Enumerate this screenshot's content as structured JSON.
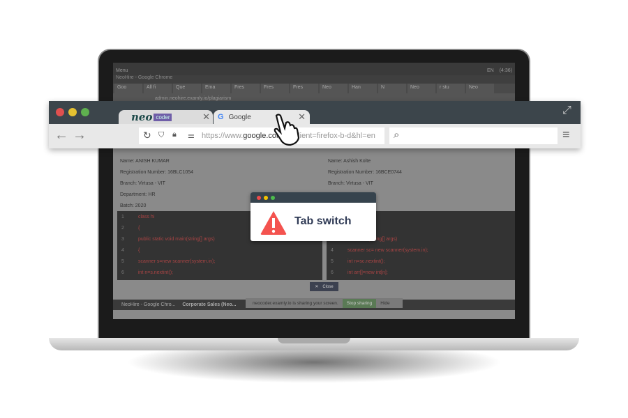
{
  "system_bar": {
    "menu": "Menu",
    "time": "(4:36)",
    "lang": "EN"
  },
  "window_title": "NeoHire - Google Chrome",
  "background_tabs": [
    "Goo",
    "All fi",
    "Que",
    "Ema",
    "Fres",
    "Fres",
    "Fres",
    "Neo",
    "Han",
    "N",
    "Neo",
    "r stu",
    "Neo"
  ],
  "background_url": "admin.neohire.examly.io/plagiarism",
  "candidates": [
    {
      "name": "Name: ANISH KUMAR",
      "reg": "Registration Number: 16BLC1054",
      "branch": "Branch: Virtusa - VIT",
      "dept": "Department: HR",
      "batch": "Batch: 2020",
      "code": [
        [
          "1",
          "class hi"
        ],
        [
          "2",
          "{"
        ],
        [
          "3",
          "public static void main(string[] args)"
        ],
        [
          "4",
          "{"
        ],
        [
          "5",
          "scanner s=new scanner(system.in);"
        ],
        [
          "6",
          "int n=s.nextint();"
        ]
      ]
    },
    {
      "name": "Name: Ashish Kolte",
      "reg": "Registration Number: 16BCE0744",
      "branch": "Branch: Virtusa - VIT",
      "code": [
        [
          "",
          "void main(string[] args)"
        ],
        [
          "4",
          "scanner sc= new scanner(system.in);"
        ],
        [
          "5",
          "int n=sc.nextint();"
        ],
        [
          "6",
          "int arr[]=new int[n];"
        ]
      ]
    }
  ],
  "dialog": {
    "title": "Tab switch",
    "icon": "warning-triangle-icon"
  },
  "close_label": "Close",
  "taskbar": {
    "items": [
      "NeoHire - Google Chro...",
      "Corporate Sales (Neo..."
    ],
    "share_text": "neocoder.examly.io is sharing your screen.",
    "stop": "Stop sharing",
    "hide": "Hide"
  },
  "browser": {
    "tab1_logo": "neo",
    "tab1_logo_badge": "coder",
    "tab2": "Google",
    "url_prefix": "https://www.",
    "url_domain": "google.com",
    "url_suffix": "/?&client=firefox-b-d&hl=en"
  },
  "colors": {
    "warning": "#f4534f",
    "neo": "#1d4a4a",
    "coder_badge": "#6f5ea8"
  }
}
